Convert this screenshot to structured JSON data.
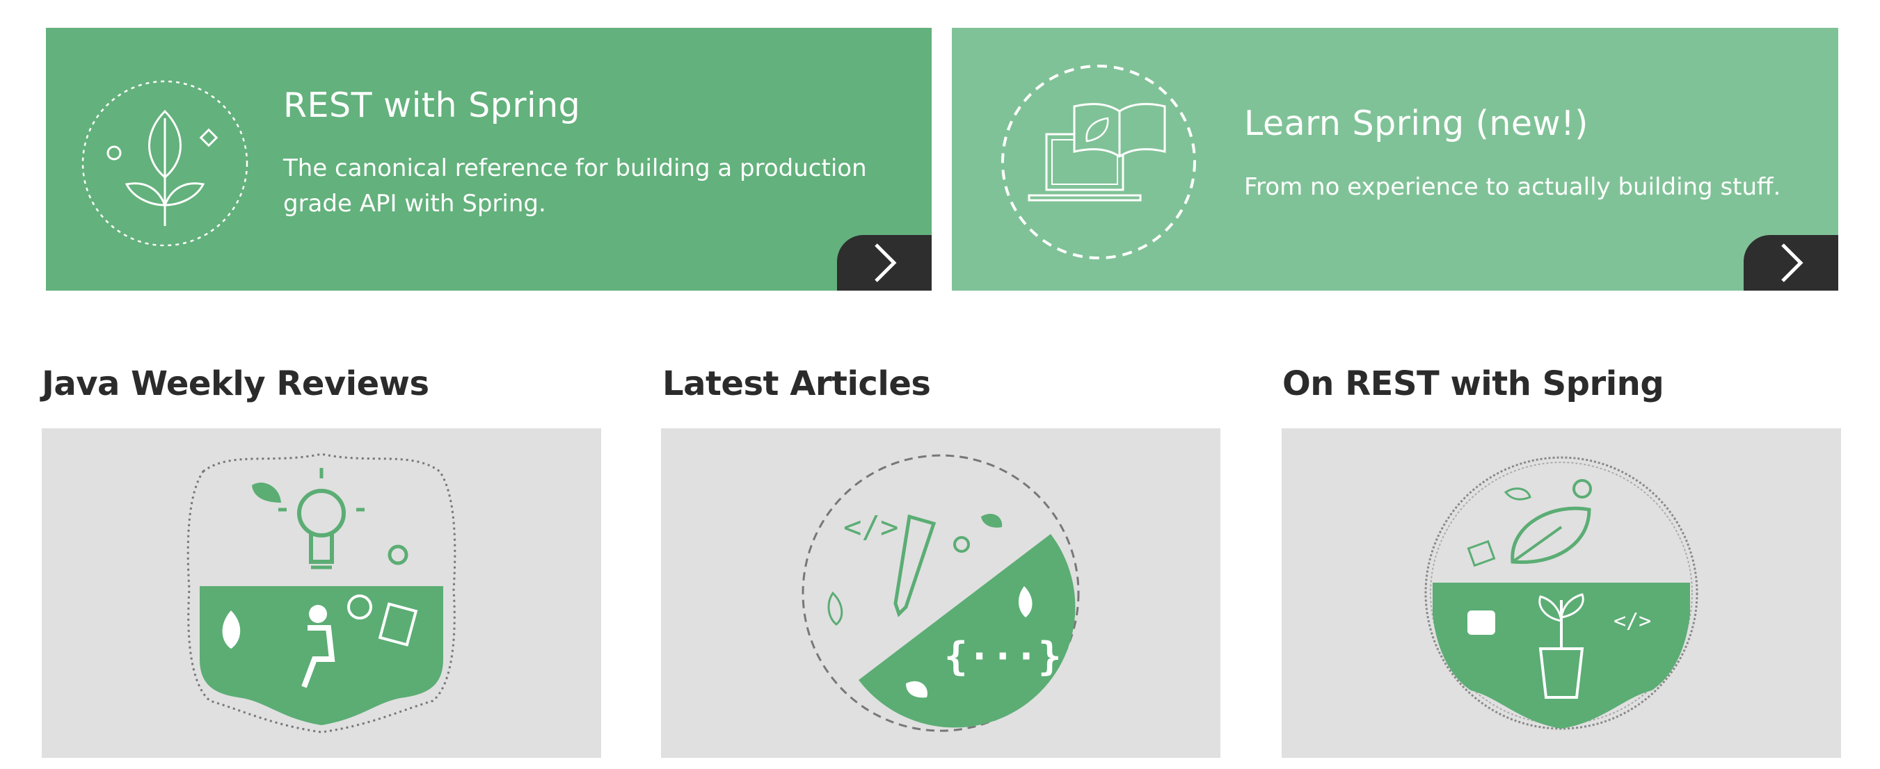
{
  "promos": [
    {
      "title": "REST with Spring",
      "description": "The canonical reference for building a production grade API with Spring.",
      "button_icon": "chevron-right-icon",
      "badge_icon": "sprout-badge-icon",
      "background": "#63b17c"
    },
    {
      "title": "Learn Spring (new!)",
      "description": "From no experience to actually building stuff.",
      "button_icon": "chevron-right-icon",
      "badge_icon": "laptop-book-badge-icon",
      "background": "#80c297"
    }
  ],
  "sections": [
    {
      "heading": "Java Weekly Reviews",
      "illustration": "lightbulb-reader-badge-icon"
    },
    {
      "heading": "Latest Articles",
      "illustration": "pencil-code-badge-icon"
    },
    {
      "heading": "On REST with Spring",
      "illustration": "potted-plant-badge-icon"
    }
  ],
  "colors": {
    "accent_green": "#5bad74",
    "dark_button": "#2e2e2e",
    "card_background": "#e0e0e0",
    "heading_text": "#2b2b2b"
  }
}
